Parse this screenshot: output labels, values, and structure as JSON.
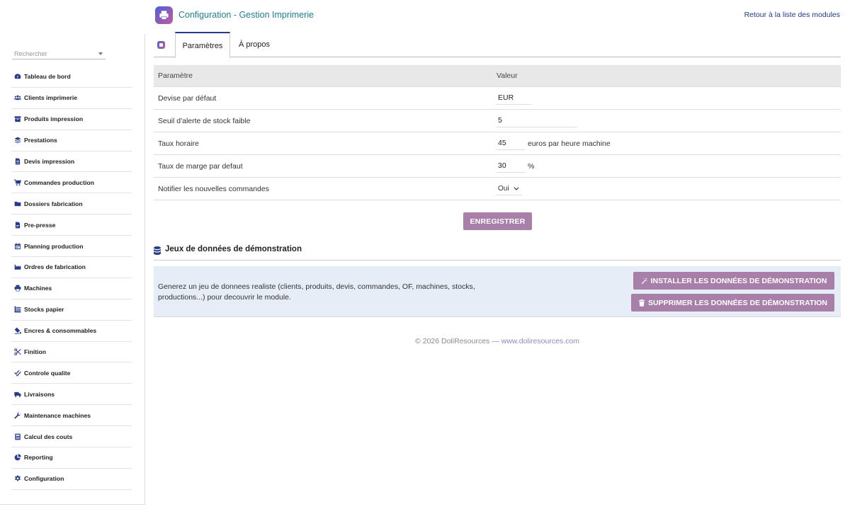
{
  "header": {
    "title": "Configuration - Gestion Imprimerie",
    "back_link": "Retour à la liste des modules"
  },
  "sidebar": {
    "search_placeholder": "Rechercher",
    "items": [
      {
        "label": "Tableau de bord",
        "icon": "dashboard-icon"
      },
      {
        "label": "Clients imprimerie",
        "icon": "users-icon"
      },
      {
        "label": "Produits impression",
        "icon": "box-icon"
      },
      {
        "label": "Prestations",
        "icon": "layers-icon"
      },
      {
        "label": "Devis impression",
        "icon": "document-icon"
      },
      {
        "label": "Commandes production",
        "icon": "cart-icon"
      },
      {
        "label": "Dossiers fabrication",
        "icon": "folder-icon"
      },
      {
        "label": "Pre-presse",
        "icon": "file-icon"
      },
      {
        "label": "Planning production",
        "icon": "calendar-icon"
      },
      {
        "label": "Ordres de fabrication",
        "icon": "industry-icon"
      },
      {
        "label": "Machines",
        "icon": "printer-icon"
      },
      {
        "label": "Stocks papier",
        "icon": "paper-stack-icon"
      },
      {
        "label": "Encres & consommables",
        "icon": "fill-drip-icon"
      },
      {
        "label": "Finition",
        "icon": "scissors-icon"
      },
      {
        "label": "Controle qualite",
        "icon": "check-double-icon"
      },
      {
        "label": "Livraisons",
        "icon": "truck-icon"
      },
      {
        "label": "Maintenance machines",
        "icon": "wrench-icon"
      },
      {
        "label": "Calcul des couts",
        "icon": "calculator-icon"
      },
      {
        "label": "Reporting",
        "icon": "pie-chart-icon"
      },
      {
        "label": "Configuration",
        "icon": "gear-icon"
      }
    ]
  },
  "tabs": {
    "params": "Paramètres",
    "about": "À propos"
  },
  "params_table": {
    "col_param": "Paramètre",
    "col_value": "Valeur",
    "rows": [
      {
        "label": "Devise par défaut",
        "value": "EUR",
        "unit": ""
      },
      {
        "label": "Seuil d'alerte de stock faible",
        "value": "5",
        "unit": ""
      },
      {
        "label": "Taux horaire",
        "value": "45",
        "unit": "euros par heure machine"
      },
      {
        "label": "Taux de marge par defaut",
        "value": "30",
        "unit": "%"
      },
      {
        "label": "Notifier les nouvelles commandes",
        "value": "Oui",
        "unit": ""
      }
    ]
  },
  "save_button": "ENREGISTRER",
  "demo": {
    "title": "Jeux de données de démonstration",
    "description": "Generez un jeu de donnees realiste (clients, produits, devis, commandes, OF, machines, stocks, productions...) pour decouvrir le module.",
    "install_button": "INSTALLER LES DONNÉES DE DÉMONSTRATION",
    "delete_button": "SUPPRIMER LES DONNÉES DE DÉMONSTRATION"
  },
  "footer": {
    "text": "© 2026 DoliResources — ",
    "link": "www.doliresources.com"
  },
  "colors": {
    "accent": "#263c8a",
    "title": "#1e7e8c",
    "button": "#a77fa9",
    "demo_bg": "#e7edf6"
  }
}
